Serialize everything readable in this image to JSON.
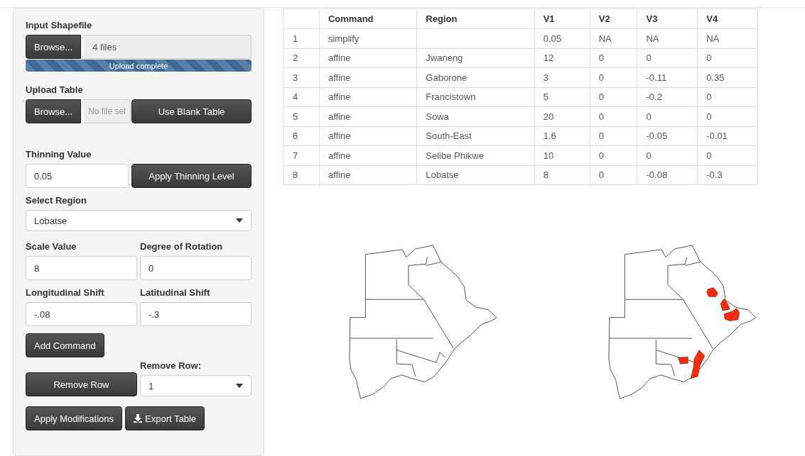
{
  "sidebar": {
    "shapefile": {
      "label": "Input Shapefile",
      "button": "Browse...",
      "value": "4 files",
      "progress": {
        "level": 1,
        "text": "Upload complete"
      }
    },
    "upload_table": {
      "label": "Upload Table",
      "button": "Browse...",
      "placeholder": "No file sel",
      "blank_button": "Use Blank Table"
    },
    "thinning": {
      "label": "Thinning Value",
      "value": "0.05",
      "button": "Apply Thinning Level"
    },
    "region": {
      "label": "Select Region",
      "value": "Lobatse"
    },
    "scale": {
      "label": "Scale Value",
      "value": "8"
    },
    "rotation": {
      "label": "Degree of Rotation",
      "value": "0"
    },
    "lon_shift": {
      "label": "Longitudinal Shift",
      "value": "-.08"
    },
    "lat_shift": {
      "label": "Latitudinal Shift",
      "value": "-.3"
    },
    "add_button": "Add Command",
    "remove_button": "Remove Row",
    "remove_select": {
      "label": "Remove Row:",
      "value": "1"
    },
    "apply_button": "Apply Modifications",
    "export_button": "Export Table"
  },
  "table": {
    "columns": [
      "Command",
      "Region",
      "V1",
      "V2",
      "V3",
      "V4"
    ],
    "rows": [
      {
        "index": "1",
        "cells": [
          "simplify",
          "",
          "0.05",
          "NA",
          "NA",
          "NA"
        ]
      },
      {
        "index": "2",
        "cells": [
          "affine",
          "Jwaneng",
          "12",
          "0",
          "0",
          "0"
        ]
      },
      {
        "index": "3",
        "cells": [
          "affine",
          "Gaborone",
          "3",
          "0",
          "-0.11",
          "0.35"
        ]
      },
      {
        "index": "4",
        "cells": [
          "affine",
          "Francistown",
          "5",
          "0",
          "-0.2",
          "0"
        ]
      },
      {
        "index": "5",
        "cells": [
          "affine",
          "Sowa",
          "20",
          "0",
          "0",
          "0"
        ]
      },
      {
        "index": "6",
        "cells": [
          "affine",
          "South-East",
          "1.6",
          "0",
          "-0.05",
          "-0.01"
        ]
      },
      {
        "index": "7",
        "cells": [
          "affine",
          "Selibe Phikwe",
          "10",
          "0",
          "0",
          "0"
        ]
      },
      {
        "index": "8",
        "cells": [
          "affine",
          "Lobatse",
          "8",
          "0",
          "-0.08",
          "-0.3"
        ]
      }
    ]
  },
  "maps": [
    {
      "highlighted": false
    },
    {
      "highlighted": true
    }
  ]
}
